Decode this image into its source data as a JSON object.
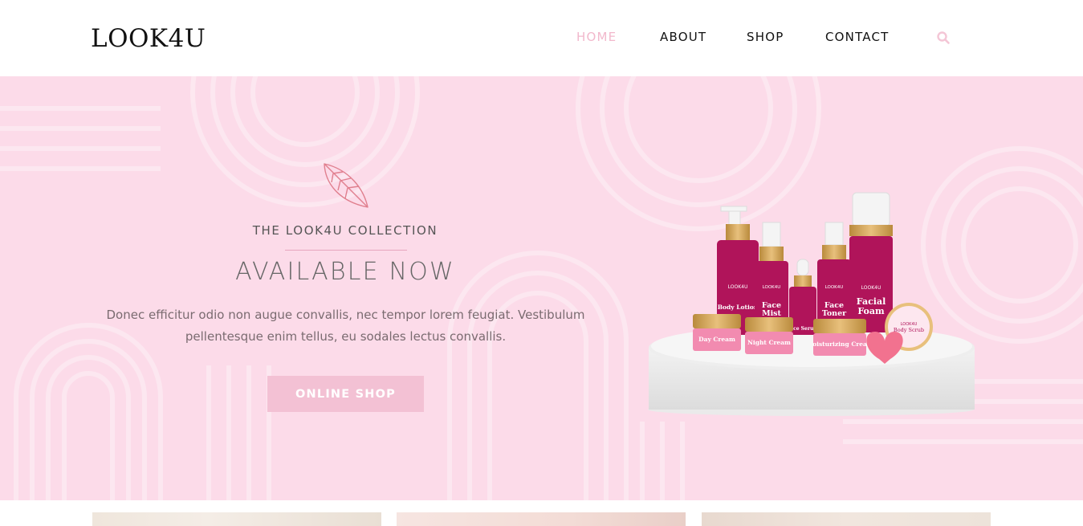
{
  "header": {
    "logo": "LOOK4U",
    "nav": [
      {
        "label": "HOME",
        "active": true
      },
      {
        "label": "ABOUT",
        "active": false
      },
      {
        "label": "SHOP",
        "active": false
      },
      {
        "label": "CONTACT",
        "active": false
      }
    ],
    "search_icon": "search-icon"
  },
  "hero": {
    "eyebrow": "THE LOOK4U COLLECTION",
    "headline": "AVAILABLE NOW",
    "body_line1": "Donec efficitur odio non augue convallis, nec tempor lorem feugiat.  Vestibulum",
    "body_line2": "pellentesque enim tellus, eu sodales lectus convallis.",
    "button_label": "ONLINE SHOP",
    "leaf_icon": "leaf-icon",
    "products": {
      "lotion": {
        "brand": "LOOK4U",
        "name": "Body Lotion"
      },
      "mist": {
        "brand": "LOOK4U",
        "name_line1": "Face",
        "name_line2": "Mist"
      },
      "serum": {
        "name": "Face Serum"
      },
      "toner": {
        "brand": "LOOK4U",
        "name_line1": "Face",
        "name_line2": "Toner"
      },
      "foam": {
        "brand": "LOOK4U",
        "name_line1": "Facial",
        "name_line2": "Foam"
      },
      "scrub": {
        "brand": "LOOK4U",
        "name": "Body Scrub"
      },
      "day_cream": {
        "name": "Day Cream"
      },
      "night_cream": {
        "name": "Night Cream"
      },
      "moisturizing_cream": {
        "name": "oisturizing Crea"
      }
    }
  },
  "colors": {
    "accent": "#f2b8cc",
    "hero_bg": "#fcdbe9",
    "button_bg": "#f3c1d4",
    "product_magenta": "#b0145a"
  }
}
